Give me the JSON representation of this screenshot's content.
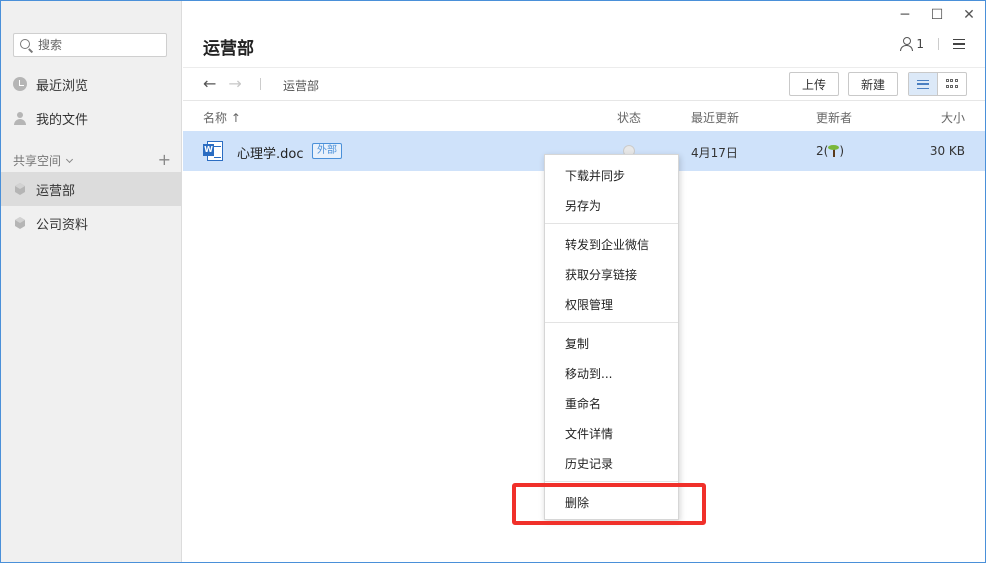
{
  "sidebar": {
    "search_placeholder": "搜索",
    "recent": "最近浏览",
    "my_files": "我的文件",
    "shared_section": "共享空间",
    "spaces": [
      "运营部",
      "公司资料"
    ]
  },
  "window": {
    "minimize": "─",
    "maximize": "☐",
    "close": "✕"
  },
  "header": {
    "title": "运营部",
    "member_count": "1"
  },
  "toolbar": {
    "back": "←",
    "forward": "→",
    "breadcrumb": "运营部",
    "upload": "上传",
    "new": "新建"
  },
  "table": {
    "columns": {
      "name": "名称 ↑",
      "status": "状态",
      "updated": "最近更新",
      "updater": "更新者",
      "size": "大小"
    },
    "rows": [
      {
        "name": "心理学.doc",
        "badge": "外部",
        "file_icon": "W",
        "updated": "4月17日",
        "updater_prefix": "2(",
        "updater_suffix": ")",
        "size": "30 KB"
      }
    ]
  },
  "context_menu": {
    "items": [
      "下载并同步",
      "另存为",
      "转发到企业微信",
      "获取分享链接",
      "权限管理",
      "复制",
      "移动到...",
      "重命名",
      "文件详情",
      "历史记录",
      "删除"
    ]
  },
  "colors": {
    "accent": "#4a90d9",
    "selected_row": "#cfe2fa",
    "highlight": "#f0302a"
  }
}
